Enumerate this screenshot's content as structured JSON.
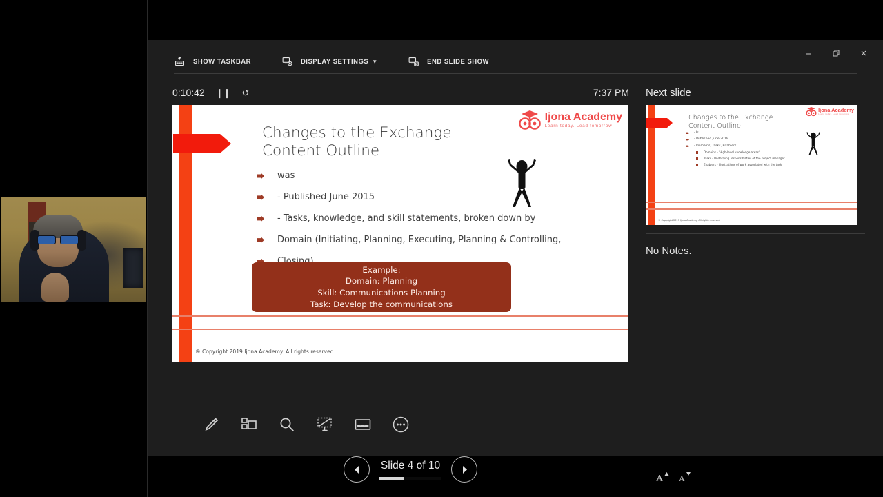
{
  "toolbar": {
    "items": [
      {
        "icon": "show-taskbar-icon",
        "label": "SHOW TASKBAR",
        "caret": ""
      },
      {
        "icon": "display-settings-icon",
        "label": "DISPLAY SETTINGS",
        "caret": "▼"
      },
      {
        "icon": "end-slide-show-icon",
        "label": "END SLIDE SHOW",
        "caret": ""
      }
    ]
  },
  "window_controls": {
    "minimize": "minimize-icon",
    "restore": "restore-icon",
    "close": "close-icon"
  },
  "status": {
    "timer": "0:10:42",
    "pause_icon": "❙❙",
    "reset_icon": "↺",
    "clock": "7:37 PM"
  },
  "slide": {
    "logo_name": "Ijona Academy",
    "logo_tagline": "Learn today. Lead tomorrow",
    "title": "Changes to the Exchange Content Outline",
    "bullets": [
      "was",
      "  - Published June 2015",
      "  - Tasks, knowledge, and skill statements, broken down by",
      "    Domain (Initiating, Planning, Executing, Planning & Controlling,",
      "    Closing)"
    ],
    "callout_lines": [
      "Example:",
      "Domain: Planning",
      "Skill: Communications Planning",
      "Task: Develop the communications"
    ],
    "copyright": "® Copyright 2019 Ijona Academy. All rights reserved",
    "accent_color": "#f44114",
    "callout_color": "#93301a"
  },
  "tools": [
    {
      "name": "pen-icon",
      "label": "Pen"
    },
    {
      "name": "all-slides-icon",
      "label": "See all slides"
    },
    {
      "name": "zoom-icon",
      "label": "Zoom into slide"
    },
    {
      "name": "black-screen-icon",
      "label": "Black or unblack slide show"
    },
    {
      "name": "subtitles-icon",
      "label": "Toggle subtitles"
    },
    {
      "name": "more-options-icon",
      "label": "More slide show options"
    }
  ],
  "navigation": {
    "previous_label": "◀",
    "next_label": "▶",
    "counter": "Slide 4 of 10",
    "progress_percent": 40
  },
  "next_panel": {
    "label": "Next slide",
    "notes": "No Notes.",
    "font_increase": "A",
    "font_decrease": "A",
    "thumb": {
      "logo_name": "Ijona Academy",
      "logo_tagline": "Learn today. Lead tomorrow",
      "title": "Changes to the Exchange Content Outline",
      "bullets": [
        {
          "text": "· Is",
          "sub": false
        },
        {
          "text": "- Published June 2019",
          "sub": false
        },
        {
          "text": "- Domains, Tasks, Enablers",
          "sub": false
        },
        {
          "text": "Domains - 'High-level knowledge areas'",
          "sub": true
        },
        {
          "text": "Tasks - Underlying responsibilities of the project manager",
          "sub": true
        },
        {
          "text": "Enablers - Illustrations of work associated with the task",
          "sub": true
        }
      ],
      "copyright": "® Copyright 2019 Ijona Academy. All rights reserved"
    }
  }
}
